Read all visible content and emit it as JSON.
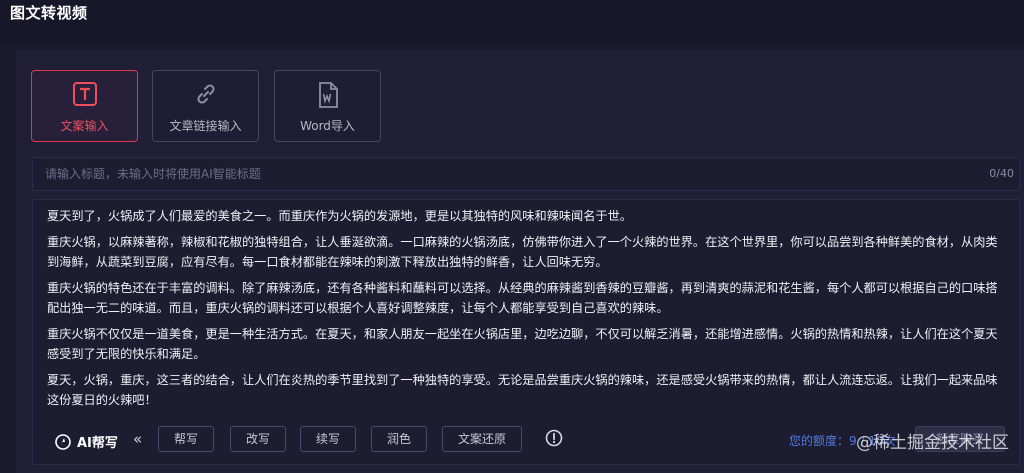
{
  "header": {
    "title": "图文转视频"
  },
  "modes": [
    {
      "label": "文案输入",
      "icon": "text-t-icon",
      "active": true
    },
    {
      "label": "文章链接输入",
      "icon": "link-icon",
      "active": false
    },
    {
      "label": "Word导入",
      "icon": "word-file-icon",
      "active": false
    }
  ],
  "title_input": {
    "value": "",
    "placeholder": "请输入标题，未输入时将使用AI智能标题",
    "counter": "0/40"
  },
  "editor": {
    "paragraphs": [
      "夏天到了，火锅成了人们最爱的美食之一。而重庆作为火锅的发源地，更是以其独特的风味和辣味闻名于世。",
      "重庆火锅，以麻辣著称，辣椒和花椒的独特组合，让人垂涎欲滴。一口麻辣的火锅汤底，仿佛带你进入了一个火辣的世界。在这个世界里，你可以品尝到各种鲜美的食材，从肉类到海鲜，从蔬菜到豆腐，应有尽有。每一口食材都能在辣味的刺激下释放出独特的鲜香，让人回味无穷。",
      "重庆火锅的特色还在于丰富的调料。除了麻辣汤底，还有各种酱料和蘸料可以选择。从经典的麻辣酱到香辣的豆瓣酱，再到清爽的蒜泥和花生酱，每个人都可以根据自己的口味搭配出独一无二的味道。而且，重庆火锅的调料还可以根据个人喜好调整辣度，让每个人都能享受到自己喜欢的辣味。",
      "重庆火锅不仅仅是一道美食，更是一种生活方式。在夏天，和家人朋友一起坐在火锅店里，边吃边聊，不仅可以解乏消暑，还能增进感情。火锅的热情和热辣，让人们在这个夏天感受到了无限的快乐和满足。",
      "夏天，火锅，重庆，这三者的结合，让人们在炎热的季节里找到了一种独特的享受。无论是品尝重庆火锅的辣味，还是感受火锅带来的热情，都让人流连忘返。让我们一起来品味这份夏日的火辣吧！"
    ]
  },
  "toolbar": {
    "ai_label": "AI帮写",
    "collapse": "«",
    "buttons": [
      "帮写",
      "改写",
      "续写",
      "润色",
      "文案还原"
    ],
    "quota_label": "您的额度：",
    "quota_value": "9 / 10次",
    "quota_button": "额度购买"
  },
  "watermark": "@稀土掘金技术社区",
  "colors": {
    "accent": "#e0384a",
    "background": "#1b1a2e",
    "panel": "#211f37",
    "link": "#4f7de0"
  }
}
